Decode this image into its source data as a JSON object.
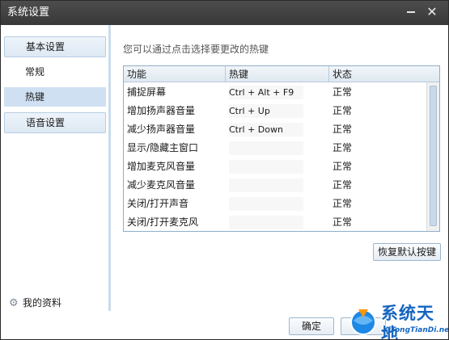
{
  "window": {
    "title": "系统设置"
  },
  "sidebar": {
    "groups": [
      {
        "label": "基本设置"
      },
      {
        "label": "语音设置"
      }
    ],
    "items": [
      {
        "label": "常规"
      },
      {
        "label": "热键"
      }
    ],
    "profile_label": "我的资料"
  },
  "content": {
    "hint": "您可以通过点击选择要更改的热键",
    "columns": [
      "功能",
      "热键",
      "状态"
    ],
    "rows": [
      {
        "function": "捕捉屏幕",
        "hotkey": "Ctrl + Alt + F9",
        "status": "正常"
      },
      {
        "function": "增加扬声器音量",
        "hotkey": "Ctrl + Up",
        "status": "正常"
      },
      {
        "function": "减少扬声器音量",
        "hotkey": "Ctrl + Down",
        "status": "正常"
      },
      {
        "function": "显示/隐藏主窗口",
        "hotkey": "",
        "status": "正常"
      },
      {
        "function": "增加麦克风音量",
        "hotkey": "",
        "status": "正常"
      },
      {
        "function": "减少麦克风音量",
        "hotkey": "",
        "status": "正常"
      },
      {
        "function": "关闭/打开声音",
        "hotkey": "",
        "status": "正常"
      },
      {
        "function": "关闭/打开麦克风",
        "hotkey": "",
        "status": "正常"
      }
    ],
    "restore_label": "恢复默认按键"
  },
  "footer": {
    "ok_label": "确定"
  },
  "watermark": {
    "text": "系统天地",
    "sub": "XiTongTianDi.net"
  },
  "colors": {
    "titlebar": "#3f3f3f",
    "selected_item": "#cfe0f2",
    "accent_border": "#8faec8",
    "watermark_blue": "#1565c0"
  }
}
